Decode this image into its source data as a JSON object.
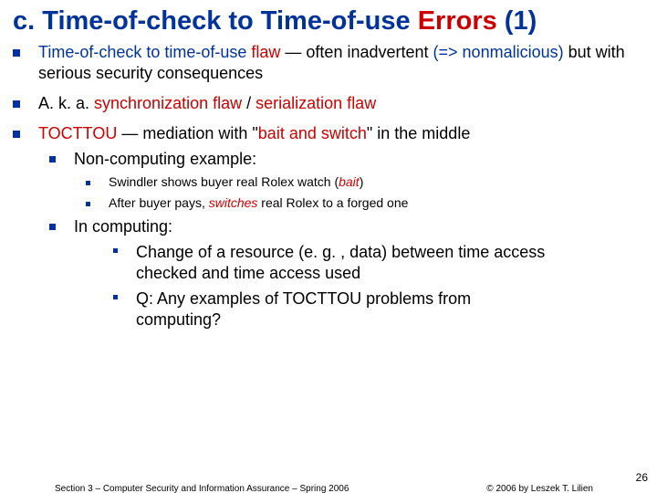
{
  "title_prefix": "c. ",
  "title_main_a": "Time-of-check to Time-of-use ",
  "title_errors": "Errors",
  "title_suffix": " (1)",
  "b1": {
    "t1a": "Time-of-check to time-of-use ",
    "t1b": "flaw",
    "t1c": " — often inadvertent ",
    "t1d": "(=> nonmalicious)",
    "t1e": " but with serious security consequences"
  },
  "b2": {
    "a": "A. k. a. ",
    "b": "synchronization flaw",
    "c": " / ",
    "d": "serialization flaw"
  },
  "b3": {
    "a": "TOCTTOU",
    "b": " — mediation with \"",
    "c": "bait and switch",
    "d": "\" in the middle"
  },
  "b3_1": "Non-computing example:",
  "b3_1_1": {
    "a": "Swindler shows buyer real Rolex watch (",
    "b": "bait",
    "c": ")"
  },
  "b3_1_2": {
    "a": "After buyer pays, ",
    "b": "switches",
    "c": " real Rolex to a forged one"
  },
  "b3_2": "In computing:",
  "b3_2_1": "Change of a resource (e. g. , data) between time access checked and time access used",
  "b3_2_2": "Q: Any examples of TOCTTOU problems from computing?",
  "footer_left": "Section 3 – Computer Security and Information Assurance – Spring 2006",
  "footer_right": "© 2006 by Leszek T. Lilien",
  "page_number": "26"
}
